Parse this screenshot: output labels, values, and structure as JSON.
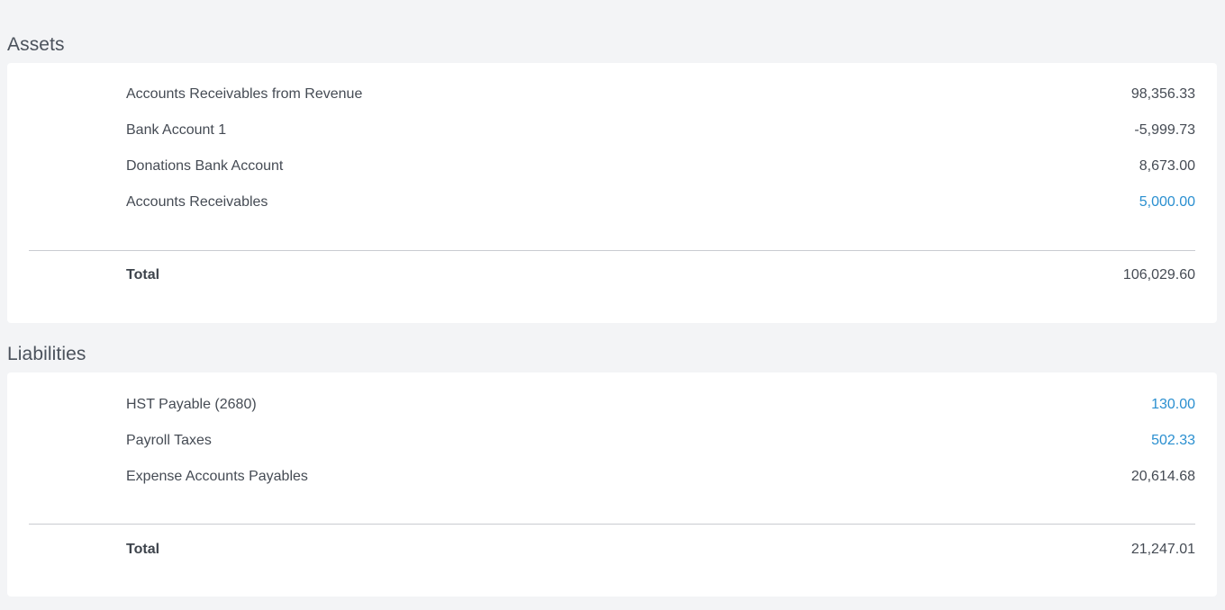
{
  "assets": {
    "title": "Assets",
    "rows": [
      {
        "label": "Accounts Receivables from Revenue",
        "amount": "98,356.33",
        "link": false
      },
      {
        "label": "Bank Account 1",
        "amount": "-5,999.73",
        "link": false
      },
      {
        "label": "Donations Bank Account",
        "amount": "8,673.00",
        "link": false
      },
      {
        "label": "Accounts Receivables",
        "amount": "5,000.00",
        "link": true
      }
    ],
    "total_label": "Total",
    "total_amount": "106,029.60"
  },
  "liabilities": {
    "title": "Liabilities",
    "rows": [
      {
        "label": "HST Payable (2680)",
        "amount": "130.00",
        "link": true
      },
      {
        "label": "Payroll Taxes",
        "amount": "502.33",
        "link": true
      },
      {
        "label": "Expense Accounts Payables",
        "amount": "20,614.68",
        "link": false
      }
    ],
    "total_label": "Total",
    "total_amount": "21,247.01"
  },
  "colors": {
    "background": "#f3f4f6",
    "card": "#ffffff",
    "text": "#454b54",
    "link": "#2a8fd0",
    "divider": "#c9ccd1"
  }
}
